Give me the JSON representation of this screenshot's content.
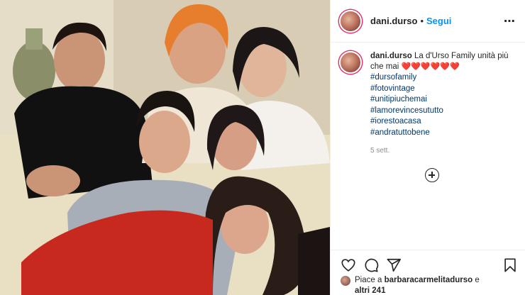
{
  "post": {
    "username": "dani.durso",
    "follow_separator": "•",
    "follow_label": "Segui",
    "more_icon": "⋯",
    "caption_user": "dani.durso",
    "caption_text": "La d'Urso Family unità più che mai",
    "hearts": "❤️❤️❤️❤️❤️❤️",
    "hashtags": [
      "#dursofamily",
      "#fotovintage",
      "#unitipiuchemai",
      "#lamorevincesututto",
      "#iorestoacasa",
      "#andratuttobene"
    ],
    "time": "5 sett.",
    "likes_prefix": "Piace a ",
    "likes_user": "barbaracarmelitadurso",
    "likes_suffix": " e",
    "likes_others": "altri 241"
  },
  "colors": {
    "follow": "#0095f6",
    "hashtag": "#00376b",
    "time": "#8e8e8e",
    "heart": "#ed4956"
  },
  "icons": [
    "heart-icon",
    "comment-icon",
    "share-icon",
    "bookmark-icon",
    "add-comment-icon",
    "more-icon"
  ]
}
